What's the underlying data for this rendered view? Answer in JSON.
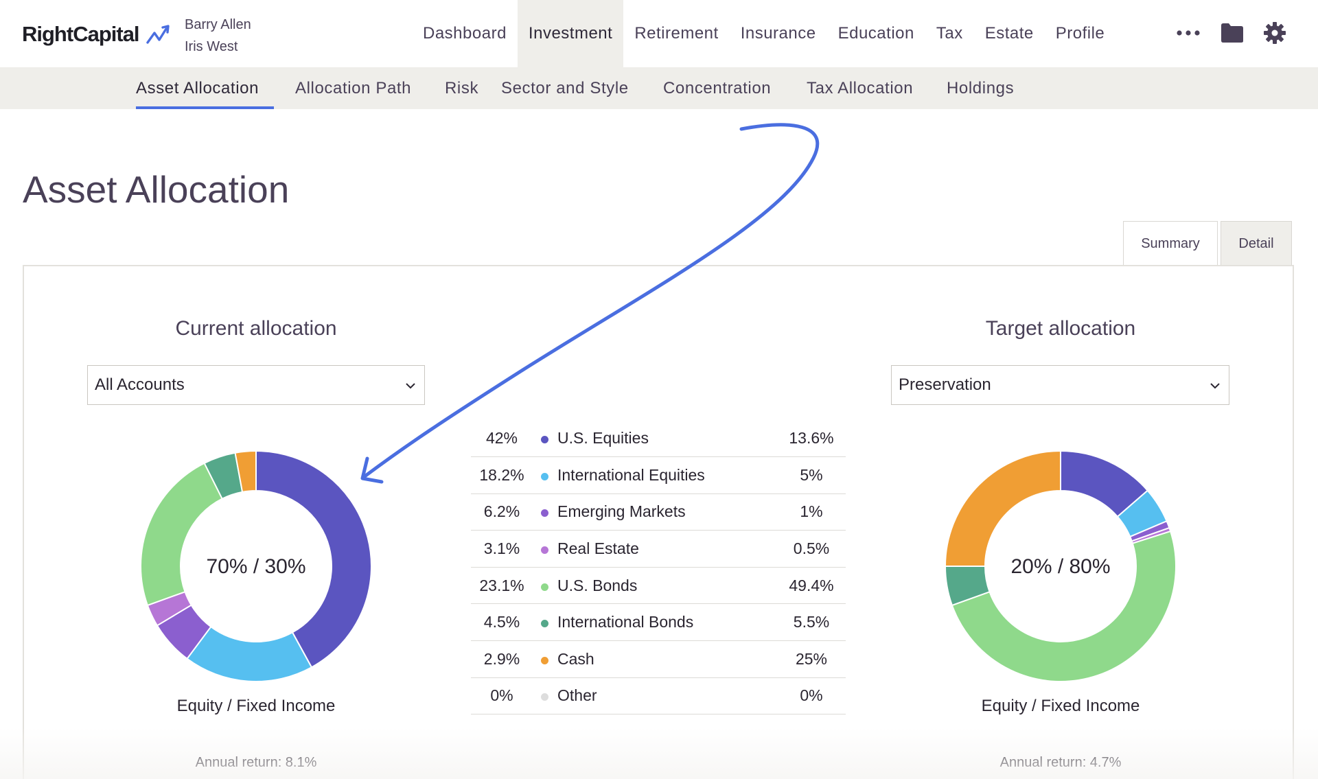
{
  "header": {
    "logo_text": "RightCapital",
    "clients": [
      "Barry Allen",
      "Iris West"
    ],
    "nav": [
      "Dashboard",
      "Investment",
      "Retirement",
      "Insurance",
      "Education",
      "Tax",
      "Estate",
      "Profile"
    ],
    "active_nav": "Investment",
    "icons": [
      "more-icon",
      "folder-icon",
      "gear-icon"
    ]
  },
  "subnav": {
    "items": [
      "Asset Allocation",
      "Allocation Path",
      "Risk",
      "Sector and Style",
      "Concentration",
      "Tax Allocation",
      "Holdings"
    ],
    "active": "Asset Allocation"
  },
  "page": {
    "title": "Asset Allocation",
    "tabs": [
      "Summary",
      "Detail"
    ],
    "active_tab": "Summary"
  },
  "current": {
    "title": "Current allocation",
    "select_value": "All Accounts",
    "center": "70% / 30%",
    "caption": "Equity / Fixed Income",
    "annual_return": "Annual return: 8.1%"
  },
  "target": {
    "title": "Target allocation",
    "select_value": "Preservation",
    "center": "20% / 80%",
    "caption": "Equity / Fixed Income",
    "annual_return": "Annual return: 4.7%"
  },
  "chart_data": [
    {
      "type": "pie",
      "role": "current",
      "categories": [
        "U.S. Equities",
        "International Equities",
        "Emerging Markets",
        "Real Estate",
        "U.S. Bonds",
        "International Bonds",
        "Cash",
        "Other"
      ],
      "values": [
        42,
        18.2,
        6.2,
        3.1,
        23.1,
        4.5,
        2.9,
        0
      ],
      "labels": [
        "42%",
        "18.2%",
        "6.2%",
        "3.1%",
        "23.1%",
        "4.5%",
        "2.9%",
        "0%"
      ]
    },
    {
      "type": "pie",
      "role": "target",
      "categories": [
        "U.S. Equities",
        "International Equities",
        "Emerging Markets",
        "Real Estate",
        "U.S. Bonds",
        "International Bonds",
        "Cash",
        "Other"
      ],
      "values": [
        13.6,
        5,
        1,
        0.5,
        49.4,
        5.5,
        25,
        0
      ],
      "labels": [
        "13.6%",
        "5%",
        "1%",
        "0.5%",
        "49.4%",
        "5.5%",
        "25%",
        "0%"
      ]
    }
  ],
  "colors": [
    "#5b55c0",
    "#56bff0",
    "#8b5fcf",
    "#b676d6",
    "#8fd98b",
    "#55a88a",
    "#f09e34",
    "#dddddd"
  ]
}
